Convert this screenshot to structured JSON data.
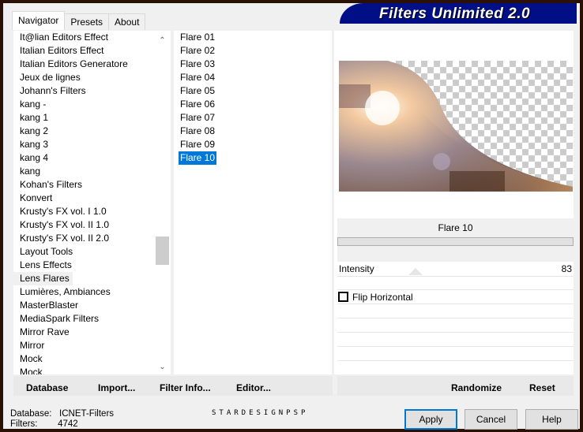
{
  "title": "Filters Unlimited 2.0",
  "tabs": [
    "Navigator",
    "Presets",
    "About"
  ],
  "categories": [
    "It@lian Editors Effect",
    "Italian Editors Effect",
    "Italian Editors Generatore",
    "Jeux de lignes",
    "Johann's Filters",
    "kang -",
    "kang 1",
    "kang 2",
    "kang 3",
    "kang 4",
    "kang",
    "Kohan's Filters",
    "Konvert",
    "Krusty's FX vol. I 1.0",
    "Krusty's FX vol. II 1.0",
    "Krusty's FX vol. II 2.0",
    "Layout Tools",
    "Lens Effects",
    "Lens Flares",
    "Lumières, Ambiances",
    "MasterBlaster",
    "MediaSpark Filters",
    "Mirror Rave",
    "Mirror",
    "Mock",
    "Mock"
  ],
  "selected_category": "Lens Flares",
  "filters": [
    "Flare 01",
    "Flare 02",
    "Flare 03",
    "Flare 04",
    "Flare 05",
    "Flare 06",
    "Flare 07",
    "Flare 08",
    "Flare 09",
    "Flare 10"
  ],
  "selected_filter": "Flare 10",
  "params": {
    "filter_name": "Flare 10",
    "intensity_label": "Intensity",
    "intensity_value": "83",
    "intensity_fraction": 0.33,
    "flip_label": "Flip Horizontal",
    "flip_checked": false
  },
  "left_buttons": [
    "Database",
    "Import...",
    "Filter Info...",
    "Editor..."
  ],
  "right_buttons": [
    "Randomize",
    "Reset"
  ],
  "status": {
    "database_label": "Database:",
    "database_value": "ICNET-Filters",
    "filters_label": "Filters:",
    "filters_value": "4742"
  },
  "watermark": "STARDESIGNPSP",
  "dialog_buttons": [
    "Apply",
    "Cancel",
    "Help"
  ],
  "colors": {
    "selection": "#0078d7",
    "banner": "#000f86",
    "frame": "#2b1006"
  }
}
